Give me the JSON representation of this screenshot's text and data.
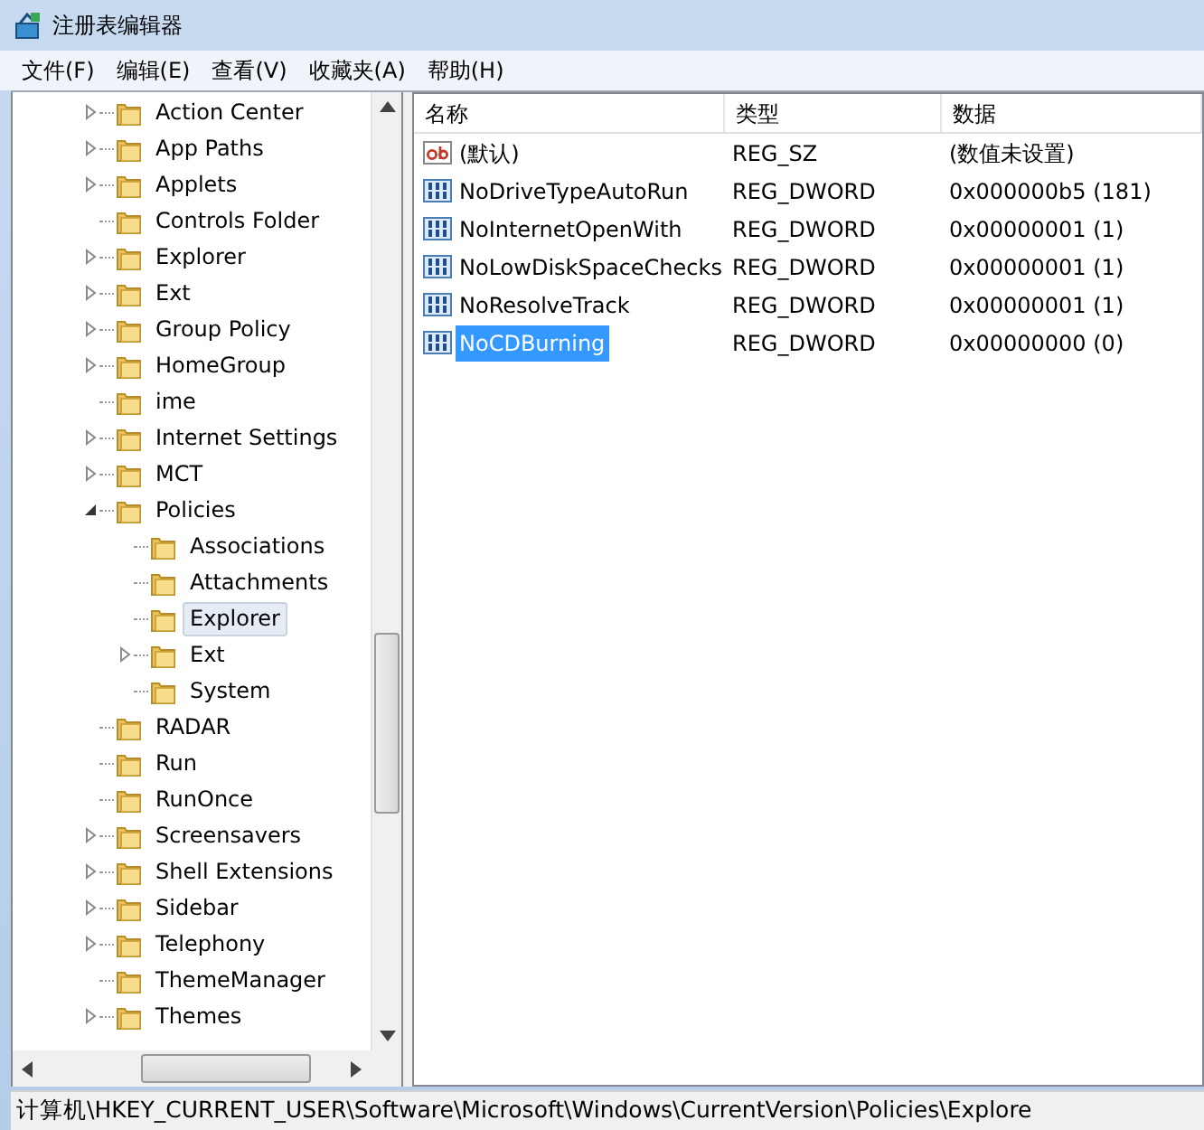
{
  "window": {
    "title": "注册表编辑器"
  },
  "menu": [
    {
      "label": "文件(F)"
    },
    {
      "label": "编辑(E)"
    },
    {
      "label": "查看(V)"
    },
    {
      "label": "收藏夹(A)"
    },
    {
      "label": "帮助(H)"
    }
  ],
  "tree": {
    "items": [
      {
        "label": "Action Center",
        "kind": "branch",
        "expanded": false,
        "selected": false
      },
      {
        "label": "App Paths",
        "kind": "branch",
        "expanded": false,
        "selected": false
      },
      {
        "label": "Applets",
        "kind": "branch",
        "expanded": false,
        "selected": false
      },
      {
        "label": "Controls Folder",
        "kind": "leaf",
        "selected": false
      },
      {
        "label": "Explorer",
        "kind": "branch",
        "expanded": false,
        "selected": false
      },
      {
        "label": "Ext",
        "kind": "branch",
        "expanded": false,
        "selected": false
      },
      {
        "label": "Group Policy",
        "kind": "branch",
        "expanded": false,
        "selected": false
      },
      {
        "label": "HomeGroup",
        "kind": "branch",
        "expanded": false,
        "selected": false
      },
      {
        "label": "ime",
        "kind": "leaf",
        "selected": false
      },
      {
        "label": "Internet Settings",
        "kind": "branch",
        "expanded": false,
        "selected": false
      },
      {
        "label": "MCT",
        "kind": "branch",
        "expanded": false,
        "selected": false
      },
      {
        "label": "Policies",
        "kind": "branch",
        "expanded": true,
        "selected": false,
        "children": [
          {
            "label": "Associations",
            "kind": "leaf",
            "selected": false
          },
          {
            "label": "Attachments",
            "kind": "leaf",
            "selected": false
          },
          {
            "label": "Explorer",
            "kind": "leaf",
            "selected": true
          },
          {
            "label": "Ext",
            "kind": "branch",
            "expanded": false,
            "selected": false
          },
          {
            "label": "System",
            "kind": "leaf",
            "selected": false
          }
        ]
      },
      {
        "label": "RADAR",
        "kind": "leaf",
        "selected": false
      },
      {
        "label": "Run",
        "kind": "leaf",
        "selected": false
      },
      {
        "label": "RunOnce",
        "kind": "leaf",
        "selected": false
      },
      {
        "label": "Screensavers",
        "kind": "branch",
        "expanded": false,
        "selected": false
      },
      {
        "label": "Shell Extensions",
        "kind": "branch",
        "expanded": false,
        "selected": false
      },
      {
        "label": "Sidebar",
        "kind": "branch",
        "expanded": false,
        "selected": false
      },
      {
        "label": "Telephony",
        "kind": "branch",
        "expanded": false,
        "selected": false
      },
      {
        "label": "ThemeManager",
        "kind": "leaf",
        "selected": false
      },
      {
        "label": "Themes",
        "kind": "branch",
        "expanded": false,
        "selected": false
      }
    ]
  },
  "values": {
    "columns": [
      "名称",
      "类型",
      "数据"
    ],
    "rows": [
      {
        "kind": "string",
        "name": "(默认)",
        "type": "REG_SZ",
        "data": "(数值未设置)",
        "selected": false
      },
      {
        "kind": "dword",
        "name": "NoDriveTypeAutoRun",
        "type": "REG_DWORD",
        "data": "0x000000b5 (181)",
        "selected": false
      },
      {
        "kind": "dword",
        "name": "NoInternetOpenWith",
        "type": "REG_DWORD",
        "data": "0x00000001 (1)",
        "selected": false
      },
      {
        "kind": "dword",
        "name": "NoLowDiskSpaceChecks",
        "type": "REG_DWORD",
        "data": "0x00000001 (1)",
        "selected": false
      },
      {
        "kind": "dword",
        "name": "NoResolveTrack",
        "type": "REG_DWORD",
        "data": "0x00000001 (1)",
        "selected": false
      },
      {
        "kind": "dword",
        "name": "NoCDBurning",
        "type": "REG_DWORD",
        "data": "0x00000000 (0)",
        "selected": true
      }
    ]
  },
  "status_bar": {
    "path": "计算机\\HKEY_CURRENT_USER\\Software\\Microsoft\\Windows\\CurrentVersion\\Policies\\Explore"
  }
}
